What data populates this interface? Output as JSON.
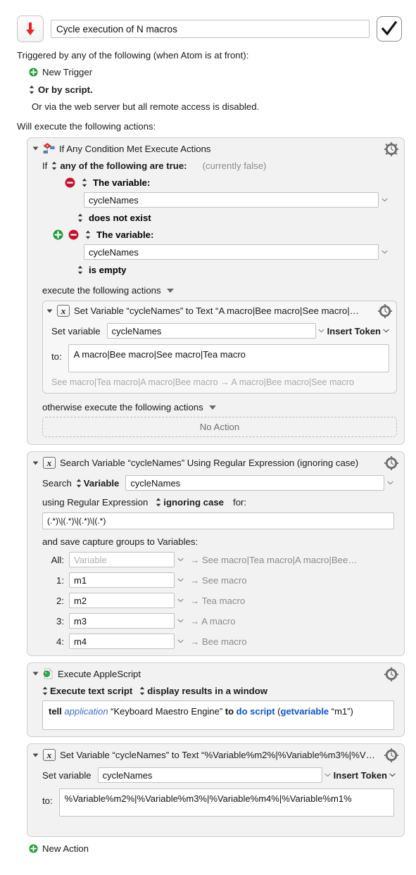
{
  "header": {
    "macro_icon": "red-down-arrow-icon",
    "title_value": "Cycle execution of N macros",
    "enabled_checkmark": "checkmark-icon"
  },
  "triggers": {
    "heading": "Triggered by any of the following (when Atom is at front):",
    "new_trigger_label": "New Trigger",
    "or_by_script": "Or by script.",
    "web_server_note": "Or via the web server but all remote access is disabled."
  },
  "actions_heading": "Will execute the following actions:",
  "actions": [
    {
      "title": "If Any Condition Met Execute Actions",
      "icon": "flowchart-decision-icon",
      "gear": "gear-clock-icon",
      "if_label": "If",
      "match_mode": "any of the following are true:",
      "status": "(currently false)",
      "conditions": [
        {
          "type_label": "The variable:",
          "variable": "cycleNames",
          "operator": "does not exist",
          "has_add": false
        },
        {
          "type_label": "The variable:",
          "variable": "cycleNames",
          "operator": "is empty",
          "has_add": true
        }
      ],
      "then_label": "execute the following actions",
      "then_action": {
        "title": "Set Variable “cycleNames” to Text “A macro|Bee macro|See macro|…",
        "icon": "variable-x-icon",
        "gear": "gear-clock-icon",
        "set_variable_label": "Set variable",
        "variable_value": "cycleNames",
        "insert_token_label": "Insert Token",
        "to_label": "to:",
        "to_value": "A macro|Bee macro|See macro|Tea macro",
        "hint": "See macro|Tea macro|A macro|Bee macro → A macro|Bee macro|See macro"
      },
      "else_label": "otherwise execute the following actions",
      "else_action": "No Action"
    },
    {
      "title": "Search Variable “cycleNames” Using Regular Expression (ignoring case)",
      "icon": "variable-x-icon",
      "gear": "gear-clock-icon",
      "search_label": "Search",
      "source_kind": "Variable",
      "source_value": "cycleNames",
      "regex_prefix": "using Regular Expression",
      "case_mode": "ignoring case",
      "for_label": "for:",
      "regex_value": "(.*)\\|(.*)\\|(.*)\\|(.*)",
      "capture_heading": "and save capture groups to Variables:",
      "capture_groups": [
        {
          "num": "All:",
          "value": "",
          "placeholder": "Variable",
          "result": "→ See macro|Tea macro|A macro|Bee…"
        },
        {
          "num": "1:",
          "value": "m1",
          "placeholder": "Variable",
          "result": "→ See macro"
        },
        {
          "num": "2:",
          "value": "m2",
          "placeholder": "Variable",
          "result": "→ Tea macro"
        },
        {
          "num": "3:",
          "value": "m3",
          "placeholder": "Variable",
          "result": "→ A macro"
        },
        {
          "num": "4:",
          "value": "m4",
          "placeholder": "Variable",
          "result": "→ Bee macro"
        }
      ]
    },
    {
      "title": "Execute AppleScript",
      "icon": "applescript-document-icon",
      "gear": "gear-clock-icon",
      "script_kind": "Execute text script",
      "results_mode": "display results in a window",
      "script": {
        "t1": "tell ",
        "t2": "application",
        "t3": " “Keyboard Maestro Engine” ",
        "t4": "to ",
        "t5": "do script",
        "t6": " (",
        "t7": "getvariable",
        "t8": " “m1”)"
      }
    },
    {
      "title": "Set Variable “cycleNames” to Text “%Variable%m2%|%Variable%m3%|%V…",
      "icon": "variable-x-icon",
      "gear": "gear-clock-icon",
      "set_variable_label": "Set variable",
      "variable_value": "cycleNames",
      "insert_token_label": "Insert Token",
      "to_label": "to:",
      "to_value": "%Variable%m2%|%Variable%m3%|%Variable%m4%|%Variable%m1%"
    }
  ],
  "footer": {
    "new_action_label": "New Action"
  },
  "colors": {
    "accent_red": "#e8232a",
    "accent_green": "#1a9c37",
    "card_bg": "#f2f2f2",
    "page_bg": "#ffffff",
    "muted": "#8c8c8c",
    "link_blue": "#0b52d6"
  }
}
